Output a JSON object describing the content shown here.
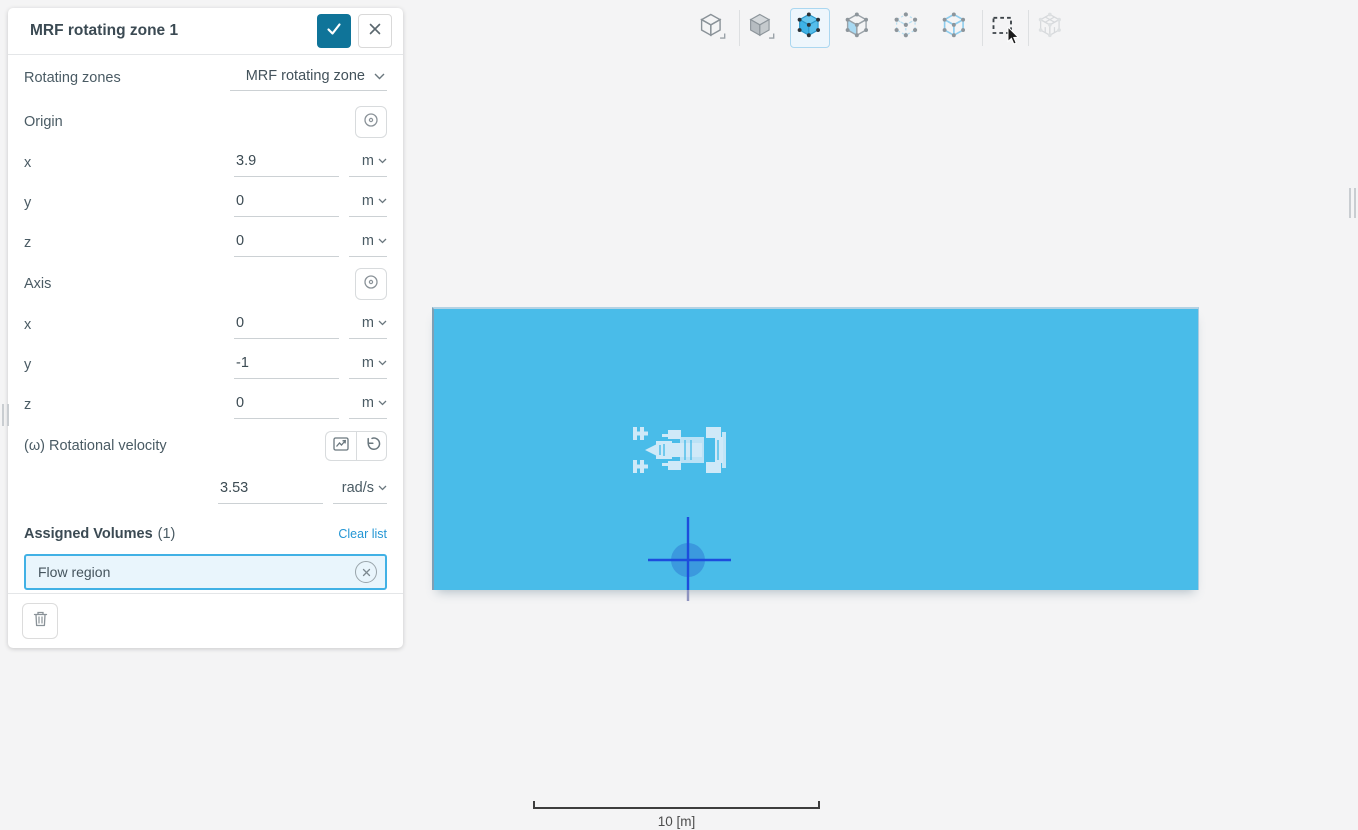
{
  "panel": {
    "title": "MRF rotating zone 1",
    "rotating_zones": {
      "label": "Rotating zones",
      "value": "MRF rotating zone"
    },
    "origin": {
      "label": "Origin",
      "fields": [
        {
          "label": "x",
          "value": "3.9",
          "unit": "m"
        },
        {
          "label": "y",
          "value": "0",
          "unit": "m"
        },
        {
          "label": "z",
          "value": "0",
          "unit": "m"
        }
      ]
    },
    "axis": {
      "label": "Axis",
      "fields": [
        {
          "label": "x",
          "value": "0",
          "unit": "m"
        },
        {
          "label": "y",
          "value": "-1",
          "unit": "m"
        },
        {
          "label": "z",
          "value": "0",
          "unit": "m"
        }
      ]
    },
    "rotational_velocity": {
      "label": "(ω) Rotational velocity",
      "value": "3.53",
      "unit": "rad/s"
    },
    "assigned_volumes": {
      "label": "Assigned Volumes",
      "count": "(1)",
      "clear_label": "Clear list",
      "items": [
        {
          "name": "Flow region"
        }
      ]
    }
  },
  "toolbar": {
    "items": [
      {
        "name": "render-mode-wireframe"
      },
      {
        "name": "render-mode-solid"
      },
      {
        "name": "select-volumes",
        "selected": true
      },
      {
        "name": "select-faces"
      },
      {
        "name": "select-vertices"
      },
      {
        "name": "select-edges"
      },
      {
        "name": "box-select"
      },
      {
        "name": "assembly-select",
        "disabled": true
      }
    ]
  },
  "viewport": {
    "scale_label": "10 [m]"
  },
  "colors": {
    "apply_button": "#0f7499",
    "link_blue": "#2496d4",
    "chip_border": "#41b1e5",
    "box_fill": "#49bce9",
    "crosshair_blue": "#1d4ddd"
  }
}
